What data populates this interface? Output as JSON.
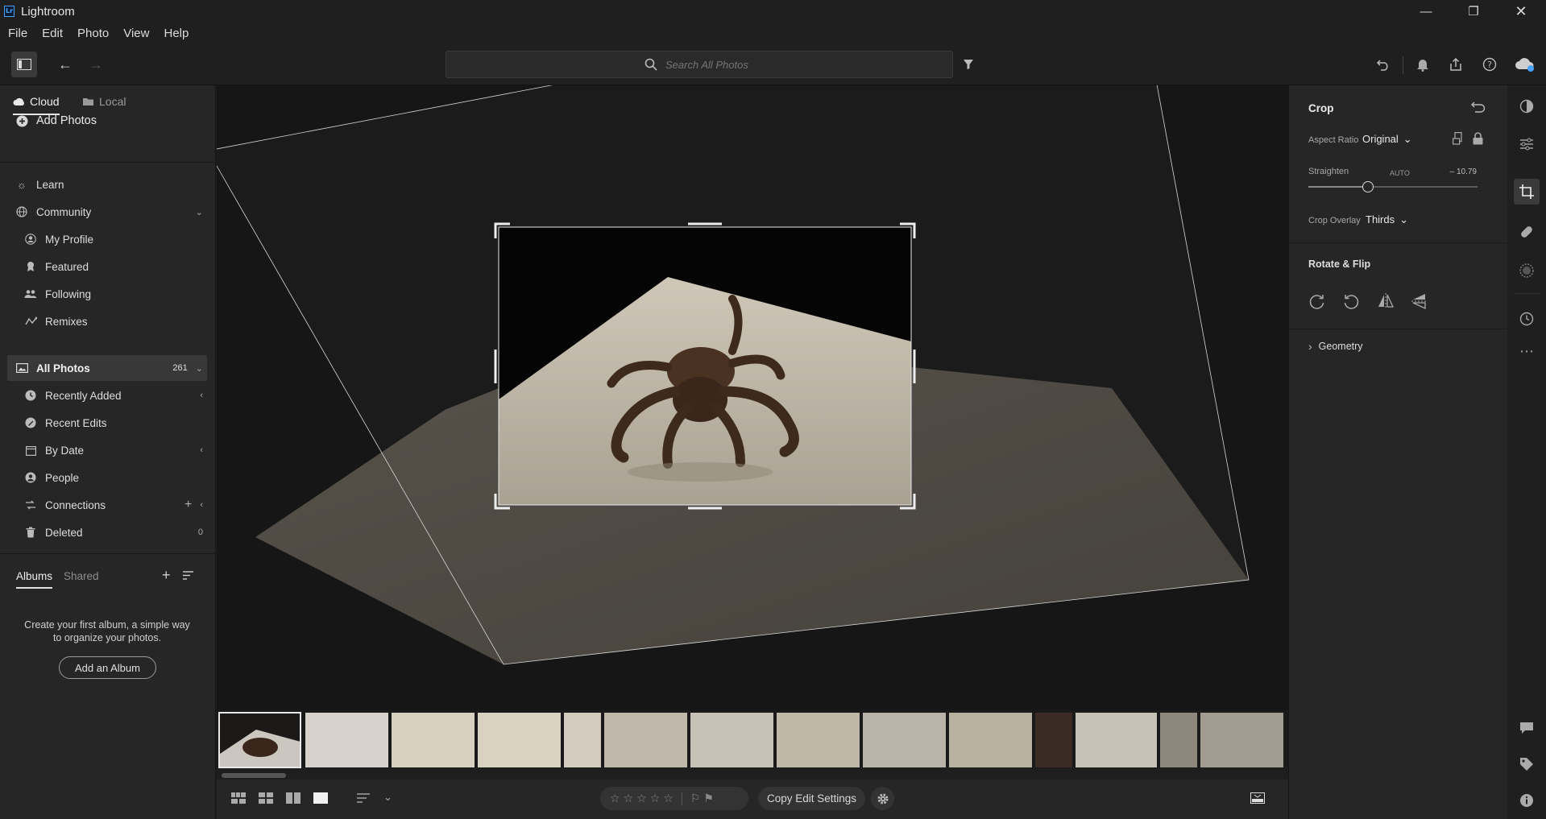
{
  "app": {
    "title": "Lightroom",
    "logo": "Lr"
  },
  "menu": [
    "File",
    "Edit",
    "Photo",
    "View",
    "Help"
  ],
  "search": {
    "placeholder": "Search All Photos"
  },
  "left": {
    "tabs": {
      "cloud": "Cloud",
      "local": "Local"
    },
    "add_photos": "Add Photos",
    "learn": "Learn",
    "community": "Community",
    "community_items": [
      "My Profile",
      "Featured",
      "Following",
      "Remixes"
    ],
    "all_photos": {
      "label": "All Photos",
      "count": "261"
    },
    "library_items": [
      "Recently Added",
      "Recent Edits",
      "By Date",
      "People",
      "Connections",
      "Deleted"
    ],
    "deleted_count": "0",
    "album_tabs": {
      "albums": "Albums",
      "shared": "Shared"
    },
    "album_empty_text": "Create your first album, a simple way to organize your photos.",
    "add_album": "Add an Album"
  },
  "crop": {
    "title": "Crop",
    "aspect_label": "Aspect Ratio",
    "aspect_value": "Original",
    "straighten_label": "Straighten",
    "auto_label": "AUTO",
    "straighten_value": "– 10.79",
    "straighten_fraction": 0.35,
    "overlay_label": "Crop Overlay",
    "overlay_value": "Thirds",
    "rotate_title": "Rotate & Flip",
    "geometry": "Geometry"
  },
  "bottom": {
    "copy_settings": "Copy Edit Settings"
  },
  "filmstrip": {
    "colors": [
      "#cbc7c0",
      "#d7d3cc",
      "#d8d1c2",
      "#d9d2c3",
      "#d3ccbe",
      "#bfb8ab",
      "#c8c2b6",
      "#bfb7a8",
      "#b9b3a8",
      "#b8b0a1",
      "#3a2b25",
      "#c8c2b6",
      "#8e877b",
      "#a39c90",
      "#b4aea2"
    ]
  },
  "colors": {
    "accent": "#4aa3ff",
    "panel": "#262626",
    "canvas": "#161616"
  }
}
